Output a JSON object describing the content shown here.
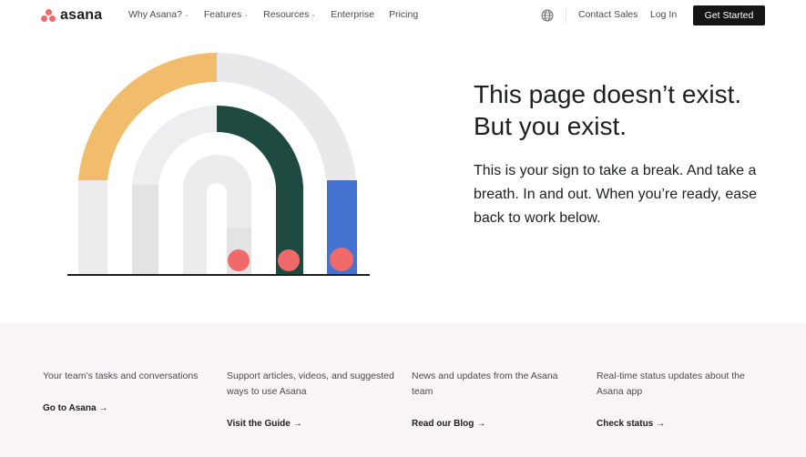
{
  "brand": {
    "name": "asana",
    "accent": "#f06a6a"
  },
  "nav": {
    "items": [
      {
        "label": "Why Asana?",
        "has_dropdown": true
      },
      {
        "label": "Features",
        "has_dropdown": true
      },
      {
        "label": "Resources",
        "has_dropdown": true
      },
      {
        "label": "Enterprise",
        "has_dropdown": false
      },
      {
        "label": "Pricing",
        "has_dropdown": false
      }
    ],
    "globe_icon": "globe-icon",
    "contact_sales": "Contact Sales",
    "log_in": "Log In",
    "get_started": "Get Started"
  },
  "message": {
    "headline_line1": "This page doesn’t exist.",
    "headline_line2": "But you exist.",
    "body": "This is your sign to take a break. And take a breath. In and out. When you’re ready, ease back to work below."
  },
  "illustration": {
    "colors": {
      "yellow": "#f1bd6c",
      "gray": "#e9e8ea",
      "dark_green": "#1f4a42",
      "blue": "#4573d2",
      "coral": "#f06a6a",
      "ground": "#1e1f21"
    }
  },
  "footer": {
    "columns": [
      {
        "description": "Your team’s tasks and conversations",
        "link": "Go to Asana"
      },
      {
        "description": "Support articles, videos, and suggested ways to use Asana",
        "link": "Visit the Guide"
      },
      {
        "description": "News and updates from the Asana team",
        "link": "Read our Blog"
      },
      {
        "description": "Real-time status updates about the Asana app",
        "link": "Check status"
      }
    ]
  }
}
